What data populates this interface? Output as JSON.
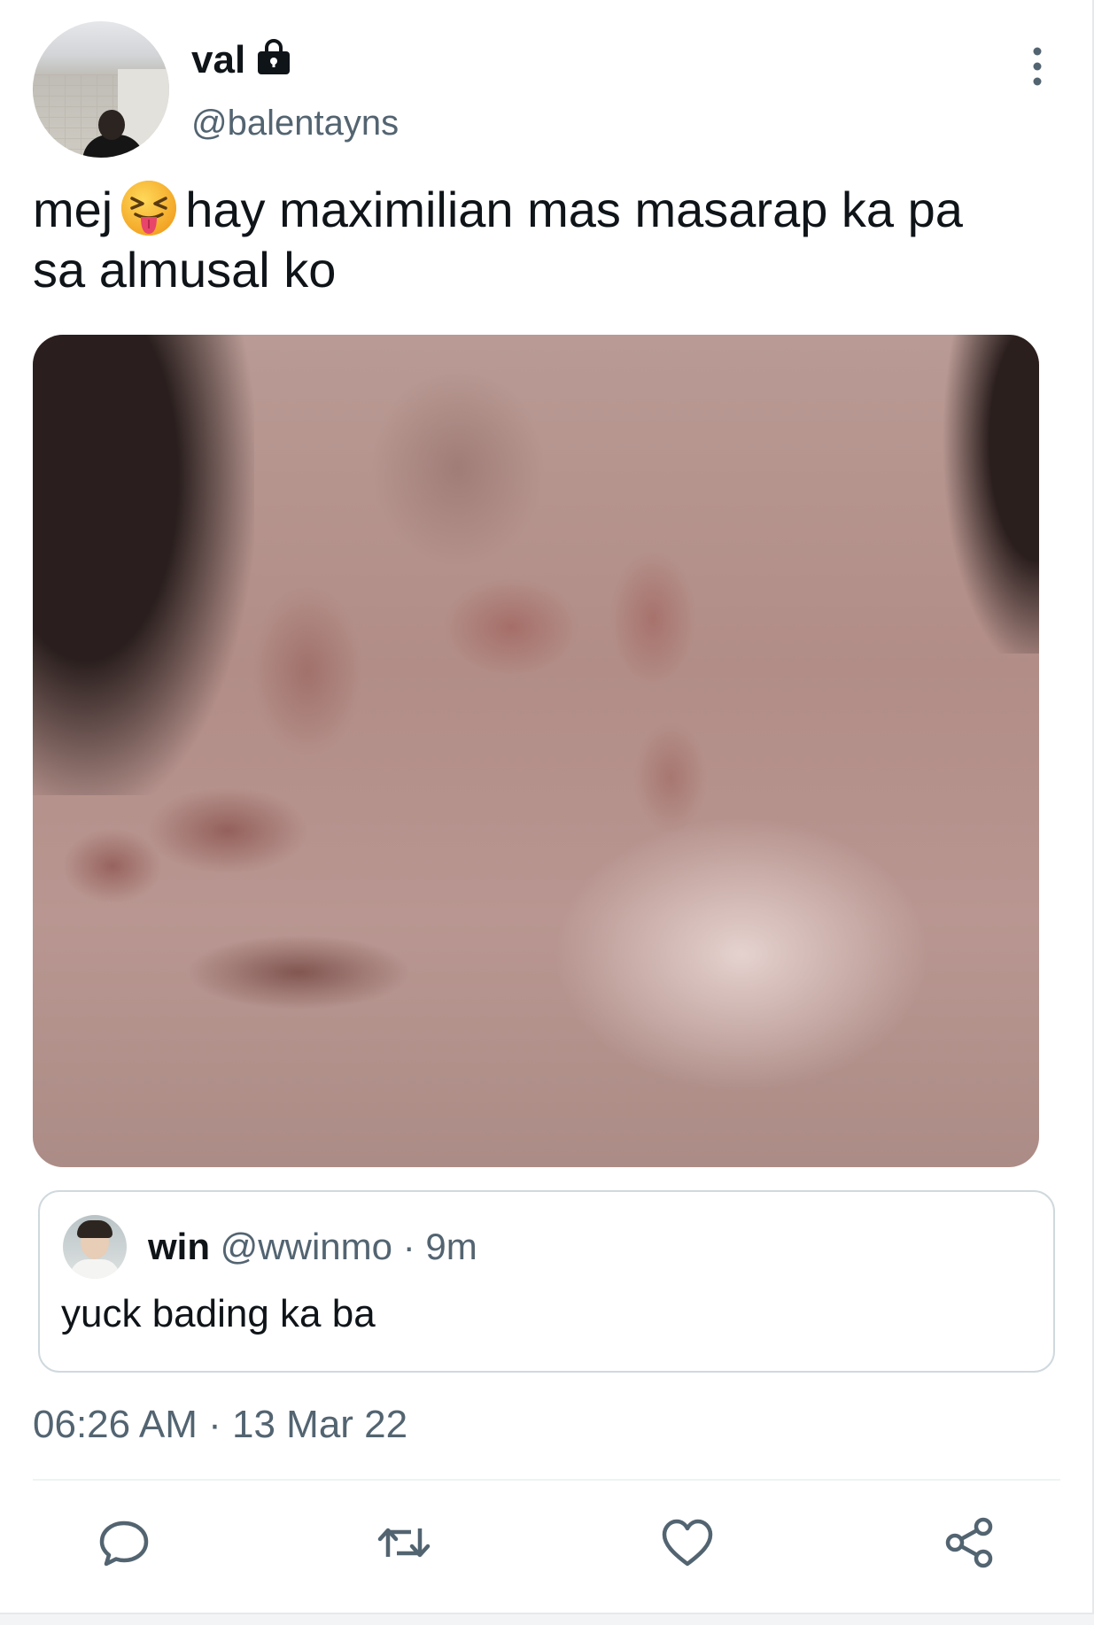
{
  "author": {
    "display_name": "val",
    "handle": "@balentayns",
    "protected_icon": "lock-icon"
  },
  "tweet": {
    "text_before_emoji": "mej",
    "emoji": "squinting-face-with-tongue",
    "text_after_emoji": "hay maximilian mas masarap ka pa",
    "text_line2": "sa almusal ko",
    "media_description": "photo"
  },
  "quoted_tweet": {
    "display_name": "win",
    "handle": "@wwinmo",
    "meta": "· 9m",
    "text": "yuck bading ka ba"
  },
  "timestamp": "06:26 AM · 13 Mar 22",
  "actions": [
    "reply-icon",
    "retweet-icon",
    "like-icon",
    "share-icon"
  ],
  "colors": {
    "text_primary": "#0f1419",
    "text_secondary": "#536471",
    "border": "#cfd9de",
    "divider": "#eff3f4"
  }
}
